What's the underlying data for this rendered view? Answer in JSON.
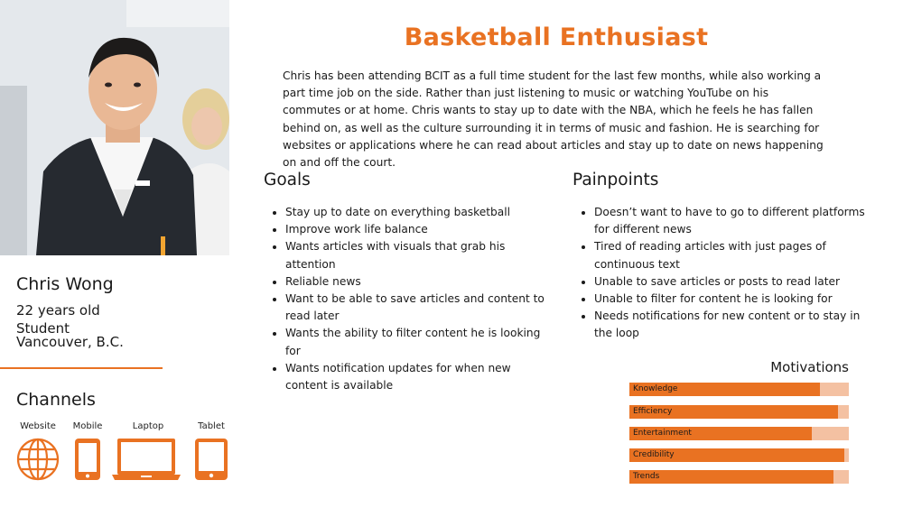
{
  "persona": {
    "name": "Chris Wong",
    "age": "22 years old",
    "occupation": "Student",
    "location": "Vancouver, B.C."
  },
  "title": "Basketball Enthusiast",
  "intro": "Chris has been attending BCIT as a full time student for the last few months, while also working a part time job on the side. Rather than just listening to music or watching YouTube on his commutes or at home. Chris wants to stay up to date with the NBA, which he feels he has fallen behind on, as well as the culture surrounding it in terms of music and fashion. He is searching for websites or applications where he can read about articles and stay up to date on news happening on and off the court.",
  "channels": {
    "title": "Channels",
    "items": [
      {
        "label": "Website",
        "icon": "globe-icon"
      },
      {
        "label": "Mobile",
        "icon": "mobile-icon"
      },
      {
        "label": "Laptop",
        "icon": "laptop-icon"
      },
      {
        "label": "Tablet",
        "icon": "tablet-icon"
      }
    ]
  },
  "goals": {
    "title": "Goals",
    "items": [
      "Stay up to date on everything basketball",
      "Improve work life balance",
      "Wants articles with visuals that grab his attention",
      "Reliable news",
      "Want to be able to save articles and content to read later",
      "Wants the ability to filter content he is looking for",
      "Wants notification updates for when new content is available"
    ]
  },
  "painpoints": {
    "title": "Painpoints",
    "items": [
      "Doesn’t want to have to go to different platforms for different news",
      "Tired of reading articles with just pages of continuous text",
      "Unable to save articles or posts to read later",
      "Unable to filter for content he is looking for",
      "Needs notifications for new content or to stay in the loop"
    ]
  },
  "motivations": {
    "title": "Motivations",
    "items": [
      {
        "label": "Knowledge",
        "level": 0.87
      },
      {
        "label": "Efficiency",
        "level": 0.95
      },
      {
        "label": "Entertainment",
        "level": 0.83
      },
      {
        "label": "Credibility",
        "level": 0.98
      },
      {
        "label": "Trends",
        "level": 0.93
      }
    ]
  },
  "colors": {
    "accent": "#e97222",
    "accent_light": "#f4c1a2",
    "text": "#1a1a1a"
  }
}
